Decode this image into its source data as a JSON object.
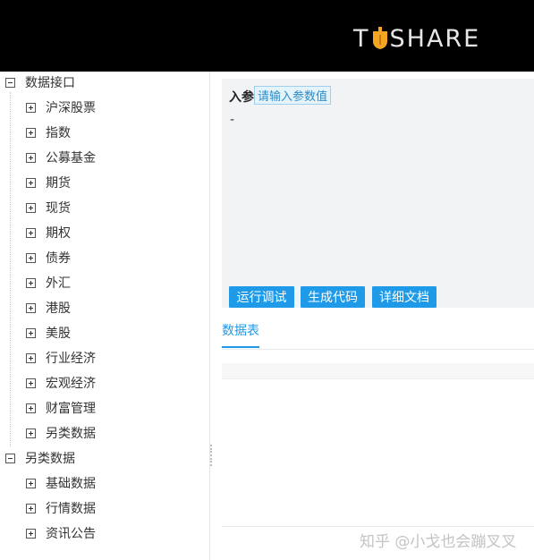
{
  "header": {
    "logo": {
      "before": "T",
      "after": "SHARE",
      "icon": "shield-icon",
      "text_color": "#e6e6e6",
      "accent": "#f5a524"
    }
  },
  "sidebar": {
    "roots": [
      {
        "label": "数据接口",
        "expanded": true,
        "children": [
          "沪深股票",
          "指数",
          "公募基金",
          "期货",
          "现货",
          "期权",
          "债券",
          "外汇",
          "港股",
          "美股",
          "行业经济",
          "宏观经济",
          "财富管理",
          "另类数据"
        ]
      },
      {
        "label": "另类数据",
        "expanded": true,
        "children": [
          "基础数据",
          "行情数据",
          "资讯公告"
        ]
      }
    ]
  },
  "params": {
    "label": "入参",
    "placeholder": "请输入参数值",
    "value": "-"
  },
  "buttons": {
    "run": "运行调试",
    "generate": "生成代码",
    "docs": "详细文档"
  },
  "tabs": [
    "数据表"
  ],
  "watermark": "知乎 @小戈也会蹦叉叉",
  "colors": {
    "accent": "#1e9ae8",
    "header_bg": "#000000",
    "panel_bg": "#f2f3f5"
  }
}
